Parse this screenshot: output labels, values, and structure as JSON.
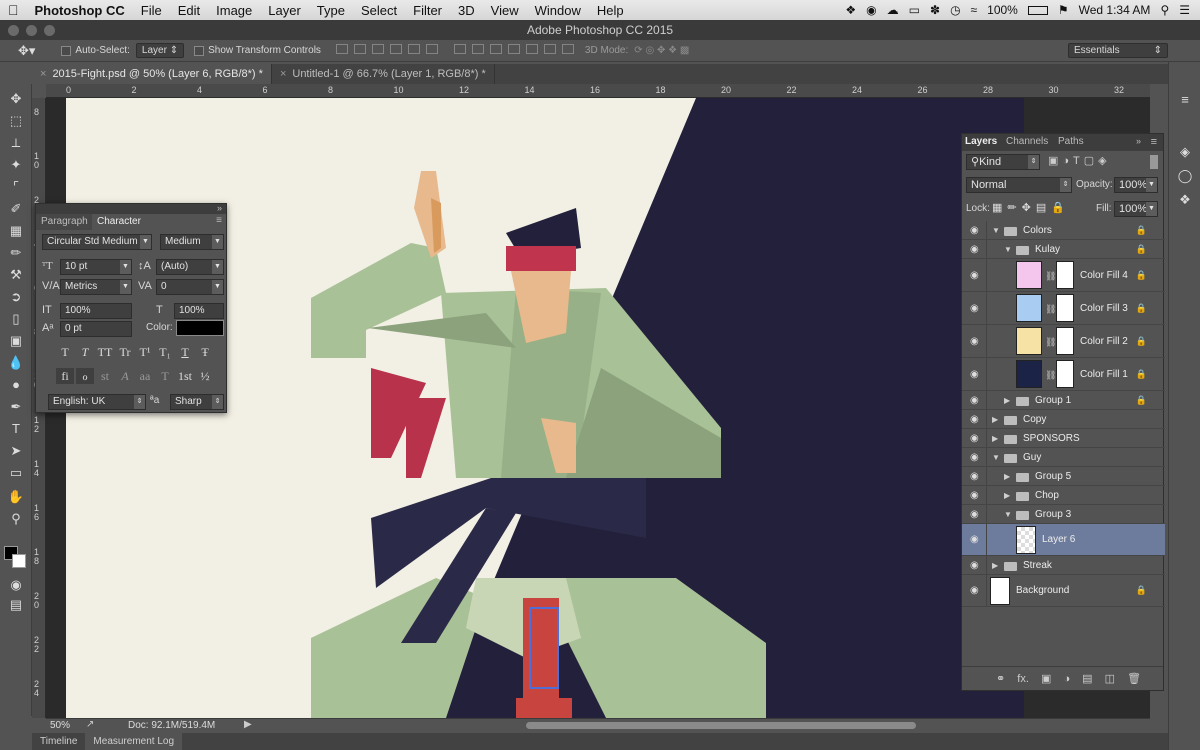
{
  "menubar": {
    "apple": "",
    "app_name": "Photoshop CC",
    "items": [
      "File",
      "Edit",
      "Image",
      "Layer",
      "Type",
      "Select",
      "Filter",
      "3D",
      "View",
      "Window",
      "Help"
    ],
    "battery": "100%",
    "clock": "Wed 1:34 AM"
  },
  "window": {
    "title": "Adobe Photoshop CC 2015"
  },
  "options_bar": {
    "auto_select_label": "Auto-Select:",
    "auto_select_value": "Layer",
    "show_transform_label": "Show Transform Controls",
    "mode_3d_label": "3D Mode:",
    "workspace": "Essentials"
  },
  "doc_tabs": [
    {
      "label": "2015-Fight.psd @ 50% (Layer 6, RGB/8*) *",
      "active": true
    },
    {
      "label": "Untitled-1 @ 66.7% (Layer 1, RGB/8*) *",
      "active": false
    }
  ],
  "rulers": {
    "h_ticks": [
      "0",
      "2",
      "4",
      "6",
      "8",
      "10",
      "12",
      "14",
      "16",
      "18",
      "20",
      "22",
      "24",
      "26",
      "28",
      "30",
      "32"
    ],
    "v_ticks": [
      "8",
      "1\n0",
      "2",
      "4",
      "6",
      "8",
      "1\n0",
      "1\n2",
      "1\n4",
      "1\n6",
      "1\n8",
      "2\n0",
      "2\n2",
      "2\n4"
    ]
  },
  "character_panel": {
    "tab_paragraph": "Paragraph",
    "tab_character": "Character",
    "font_family": "Circular Std Medium",
    "font_style": "Medium",
    "font_size": "10 pt",
    "leading": "(Auto)",
    "kerning": "Metrics",
    "tracking": "0",
    "vertical_scale": "100%",
    "horizontal_scale": "100%",
    "baseline_shift": "0 pt",
    "color_label": "Color:",
    "language": "English: UK",
    "aa_label": "ªa",
    "antialias": "Sharp",
    "type_buttons": [
      "T",
      "T",
      "TT",
      "Tr",
      "T¹",
      "T₁",
      "T",
      "Ŧ"
    ],
    "opentype_buttons": [
      "fi",
      "ℴ",
      "st",
      "A",
      "aa",
      "T",
      "1st",
      "½"
    ]
  },
  "layers_panel": {
    "tabs": [
      "Layers",
      "Channels",
      "Paths"
    ],
    "filter_kind": "Kind",
    "blend_mode": "Normal",
    "opacity_label": "Opacity:",
    "opacity": "100%",
    "lock_label": "Lock:",
    "fill_label": "Fill:",
    "fill": "100%",
    "layers": [
      {
        "name": "Colors",
        "type": "group",
        "indent": 0,
        "open": true,
        "locked": true
      },
      {
        "name": "Kulay",
        "type": "group",
        "indent": 1,
        "open": true,
        "locked": true
      },
      {
        "name": "Color Fill 4",
        "type": "fill",
        "indent": 2,
        "swatch": "#f4c6ee",
        "locked": true
      },
      {
        "name": "Color Fill 3",
        "type": "fill",
        "indent": 2,
        "swatch": "#a9cdf2",
        "locked": true
      },
      {
        "name": "Color Fill 2",
        "type": "fill",
        "indent": 2,
        "swatch": "#f7e2a6",
        "locked": true
      },
      {
        "name": "Color Fill 1",
        "type": "fill",
        "indent": 2,
        "swatch": "#1b2447",
        "locked": true
      },
      {
        "name": "Group 1",
        "type": "group",
        "indent": 1,
        "open": false,
        "locked": true
      },
      {
        "name": "Copy",
        "type": "group",
        "indent": 0,
        "open": false,
        "locked": false
      },
      {
        "name": "SPONSORS",
        "type": "group",
        "indent": 0,
        "open": false,
        "locked": false
      },
      {
        "name": "Guy",
        "type": "group",
        "indent": 0,
        "open": true,
        "locked": false
      },
      {
        "name": "Group 5",
        "type": "group",
        "indent": 1,
        "open": false,
        "locked": false
      },
      {
        "name": "Chop",
        "type": "group",
        "indent": 1,
        "open": false,
        "locked": false
      },
      {
        "name": "Group 3",
        "type": "group",
        "indent": 1,
        "open": true,
        "locked": false
      },
      {
        "name": "Layer 6",
        "type": "pixel",
        "indent": 2,
        "selected": true,
        "locked": false
      },
      {
        "name": "Streak",
        "type": "group",
        "indent": 0,
        "open": false,
        "locked": false
      },
      {
        "name": "Background",
        "type": "background",
        "indent": 0,
        "locked": true
      }
    ]
  },
  "status": {
    "zoom": "50%",
    "doc_size": "Doc: 92.1M/519.4M"
  },
  "bottom_tabs": [
    "Timeline",
    "Measurement Log"
  ],
  "colors": {
    "canvas_bg": "#f2efe4",
    "dark_navy": "#22203a",
    "gi_green": "#a8c196",
    "gi_shadow": "#8ba27c",
    "headband": "#c0344e",
    "skin": "#e7b98c"
  }
}
